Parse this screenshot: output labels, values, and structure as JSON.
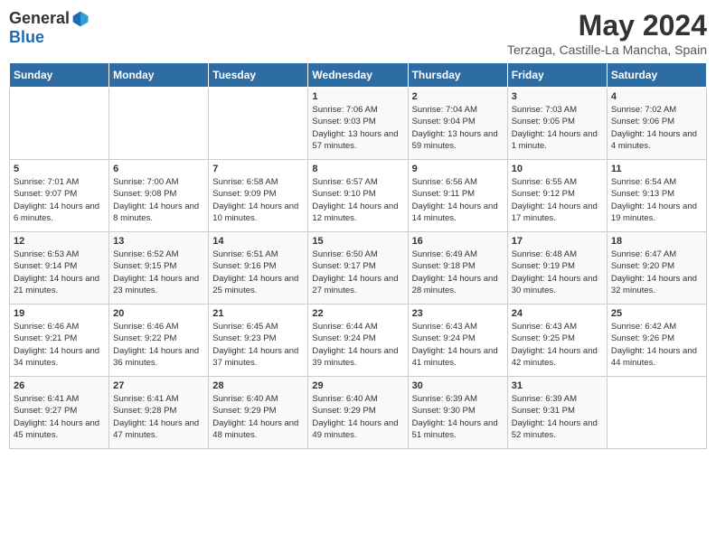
{
  "header": {
    "logo_general": "General",
    "logo_blue": "Blue",
    "month": "May 2024",
    "location": "Terzaga, Castille-La Mancha, Spain"
  },
  "days_of_week": [
    "Sunday",
    "Monday",
    "Tuesday",
    "Wednesday",
    "Thursday",
    "Friday",
    "Saturday"
  ],
  "weeks": [
    [
      {
        "day": "",
        "sunrise": "",
        "sunset": "",
        "daylight": ""
      },
      {
        "day": "",
        "sunrise": "",
        "sunset": "",
        "daylight": ""
      },
      {
        "day": "",
        "sunrise": "",
        "sunset": "",
        "daylight": ""
      },
      {
        "day": "1",
        "sunrise": "Sunrise: 7:06 AM",
        "sunset": "Sunset: 9:03 PM",
        "daylight": "Daylight: 13 hours and 57 minutes."
      },
      {
        "day": "2",
        "sunrise": "Sunrise: 7:04 AM",
        "sunset": "Sunset: 9:04 PM",
        "daylight": "Daylight: 13 hours and 59 minutes."
      },
      {
        "day": "3",
        "sunrise": "Sunrise: 7:03 AM",
        "sunset": "Sunset: 9:05 PM",
        "daylight": "Daylight: 14 hours and 1 minute."
      },
      {
        "day": "4",
        "sunrise": "Sunrise: 7:02 AM",
        "sunset": "Sunset: 9:06 PM",
        "daylight": "Daylight: 14 hours and 4 minutes."
      }
    ],
    [
      {
        "day": "5",
        "sunrise": "Sunrise: 7:01 AM",
        "sunset": "Sunset: 9:07 PM",
        "daylight": "Daylight: 14 hours and 6 minutes."
      },
      {
        "day": "6",
        "sunrise": "Sunrise: 7:00 AM",
        "sunset": "Sunset: 9:08 PM",
        "daylight": "Daylight: 14 hours and 8 minutes."
      },
      {
        "day": "7",
        "sunrise": "Sunrise: 6:58 AM",
        "sunset": "Sunset: 9:09 PM",
        "daylight": "Daylight: 14 hours and 10 minutes."
      },
      {
        "day": "8",
        "sunrise": "Sunrise: 6:57 AM",
        "sunset": "Sunset: 9:10 PM",
        "daylight": "Daylight: 14 hours and 12 minutes."
      },
      {
        "day": "9",
        "sunrise": "Sunrise: 6:56 AM",
        "sunset": "Sunset: 9:11 PM",
        "daylight": "Daylight: 14 hours and 14 minutes."
      },
      {
        "day": "10",
        "sunrise": "Sunrise: 6:55 AM",
        "sunset": "Sunset: 9:12 PM",
        "daylight": "Daylight: 14 hours and 17 minutes."
      },
      {
        "day": "11",
        "sunrise": "Sunrise: 6:54 AM",
        "sunset": "Sunset: 9:13 PM",
        "daylight": "Daylight: 14 hours and 19 minutes."
      }
    ],
    [
      {
        "day": "12",
        "sunrise": "Sunrise: 6:53 AM",
        "sunset": "Sunset: 9:14 PM",
        "daylight": "Daylight: 14 hours and 21 minutes."
      },
      {
        "day": "13",
        "sunrise": "Sunrise: 6:52 AM",
        "sunset": "Sunset: 9:15 PM",
        "daylight": "Daylight: 14 hours and 23 minutes."
      },
      {
        "day": "14",
        "sunrise": "Sunrise: 6:51 AM",
        "sunset": "Sunset: 9:16 PM",
        "daylight": "Daylight: 14 hours and 25 minutes."
      },
      {
        "day": "15",
        "sunrise": "Sunrise: 6:50 AM",
        "sunset": "Sunset: 9:17 PM",
        "daylight": "Daylight: 14 hours and 27 minutes."
      },
      {
        "day": "16",
        "sunrise": "Sunrise: 6:49 AM",
        "sunset": "Sunset: 9:18 PM",
        "daylight": "Daylight: 14 hours and 28 minutes."
      },
      {
        "day": "17",
        "sunrise": "Sunrise: 6:48 AM",
        "sunset": "Sunset: 9:19 PM",
        "daylight": "Daylight: 14 hours and 30 minutes."
      },
      {
        "day": "18",
        "sunrise": "Sunrise: 6:47 AM",
        "sunset": "Sunset: 9:20 PM",
        "daylight": "Daylight: 14 hours and 32 minutes."
      }
    ],
    [
      {
        "day": "19",
        "sunrise": "Sunrise: 6:46 AM",
        "sunset": "Sunset: 9:21 PM",
        "daylight": "Daylight: 14 hours and 34 minutes."
      },
      {
        "day": "20",
        "sunrise": "Sunrise: 6:46 AM",
        "sunset": "Sunset: 9:22 PM",
        "daylight": "Daylight: 14 hours and 36 minutes."
      },
      {
        "day": "21",
        "sunrise": "Sunrise: 6:45 AM",
        "sunset": "Sunset: 9:23 PM",
        "daylight": "Daylight: 14 hours and 37 minutes."
      },
      {
        "day": "22",
        "sunrise": "Sunrise: 6:44 AM",
        "sunset": "Sunset: 9:24 PM",
        "daylight": "Daylight: 14 hours and 39 minutes."
      },
      {
        "day": "23",
        "sunrise": "Sunrise: 6:43 AM",
        "sunset": "Sunset: 9:24 PM",
        "daylight": "Daylight: 14 hours and 41 minutes."
      },
      {
        "day": "24",
        "sunrise": "Sunrise: 6:43 AM",
        "sunset": "Sunset: 9:25 PM",
        "daylight": "Daylight: 14 hours and 42 minutes."
      },
      {
        "day": "25",
        "sunrise": "Sunrise: 6:42 AM",
        "sunset": "Sunset: 9:26 PM",
        "daylight": "Daylight: 14 hours and 44 minutes."
      }
    ],
    [
      {
        "day": "26",
        "sunrise": "Sunrise: 6:41 AM",
        "sunset": "Sunset: 9:27 PM",
        "daylight": "Daylight: 14 hours and 45 minutes."
      },
      {
        "day": "27",
        "sunrise": "Sunrise: 6:41 AM",
        "sunset": "Sunset: 9:28 PM",
        "daylight": "Daylight: 14 hours and 47 minutes."
      },
      {
        "day": "28",
        "sunrise": "Sunrise: 6:40 AM",
        "sunset": "Sunset: 9:29 PM",
        "daylight": "Daylight: 14 hours and 48 minutes."
      },
      {
        "day": "29",
        "sunrise": "Sunrise: 6:40 AM",
        "sunset": "Sunset: 9:29 PM",
        "daylight": "Daylight: 14 hours and 49 minutes."
      },
      {
        "day": "30",
        "sunrise": "Sunrise: 6:39 AM",
        "sunset": "Sunset: 9:30 PM",
        "daylight": "Daylight: 14 hours and 51 minutes."
      },
      {
        "day": "31",
        "sunrise": "Sunrise: 6:39 AM",
        "sunset": "Sunset: 9:31 PM",
        "daylight": "Daylight: 14 hours and 52 minutes."
      },
      {
        "day": "",
        "sunrise": "",
        "sunset": "",
        "daylight": ""
      }
    ]
  ]
}
